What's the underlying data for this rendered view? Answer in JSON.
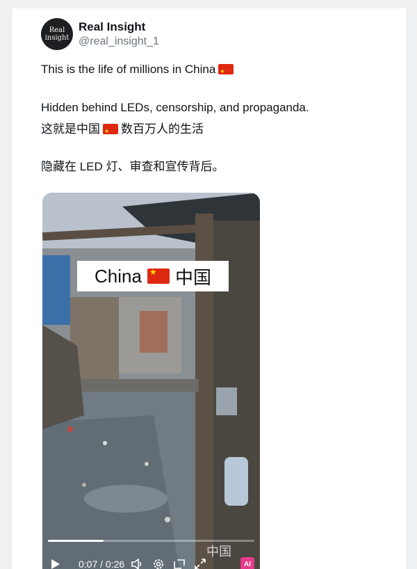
{
  "author": {
    "display_name": "Real Insight",
    "handle": "@real_insight_1",
    "avatar_line1": "Real",
    "avatar_line2": "insight"
  },
  "post": {
    "line1": "This is the life of millions in China",
    "line2": "Hidden behind LEDs, censorship, and propaganda.",
    "line3a": "这就是中国",
    "line3b": "数百万人的生活",
    "line4": "隐藏在 LED 灯、审查和宣传背后。"
  },
  "video": {
    "caption_en": "China",
    "caption_zh": "中国",
    "watermark": "中国",
    "current_time": "0:07",
    "separator": "/",
    "duration": "0:26",
    "progress_fraction": 0.27,
    "ai_badge": "AI"
  },
  "colors": {
    "flag_red": "#de2910",
    "flag_star": "#ffde00",
    "handle_gray": "#6b7480",
    "text": "#0f1419"
  },
  "icons": [
    "flag-icon",
    "play-icon",
    "volume-icon",
    "settings-icon",
    "pip-icon",
    "fullscreen-icon"
  ]
}
